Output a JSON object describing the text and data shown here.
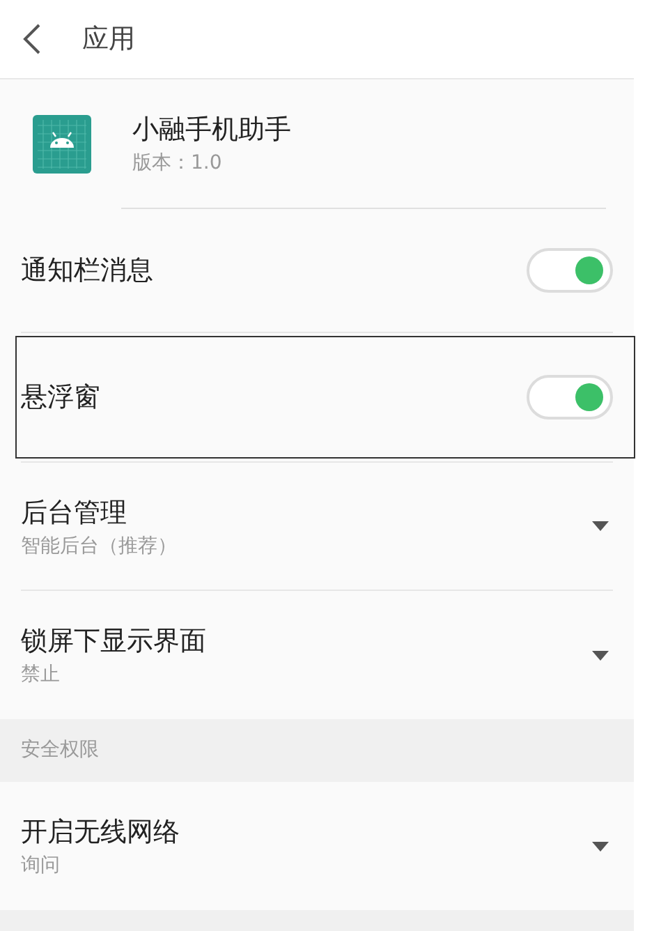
{
  "header": {
    "title": "应用"
  },
  "app": {
    "name": "小融手机助手",
    "version": "版本：1.0"
  },
  "sections": [
    {
      "items": [
        {
          "kind": "toggle",
          "label": "通知栏消息",
          "on": true,
          "highlighted": false
        },
        {
          "kind": "toggle",
          "label": "悬浮窗",
          "on": true,
          "highlighted": true
        },
        {
          "kind": "dropdown",
          "label": "后台管理",
          "value": "智能后台（推荐）"
        },
        {
          "kind": "dropdown",
          "label": "锁屏下显示界面",
          "value": "禁止"
        }
      ]
    },
    {
      "title": "安全权限",
      "items": [
        {
          "kind": "dropdown",
          "label": "开启无线网络",
          "value": "询问"
        }
      ]
    }
  ]
}
